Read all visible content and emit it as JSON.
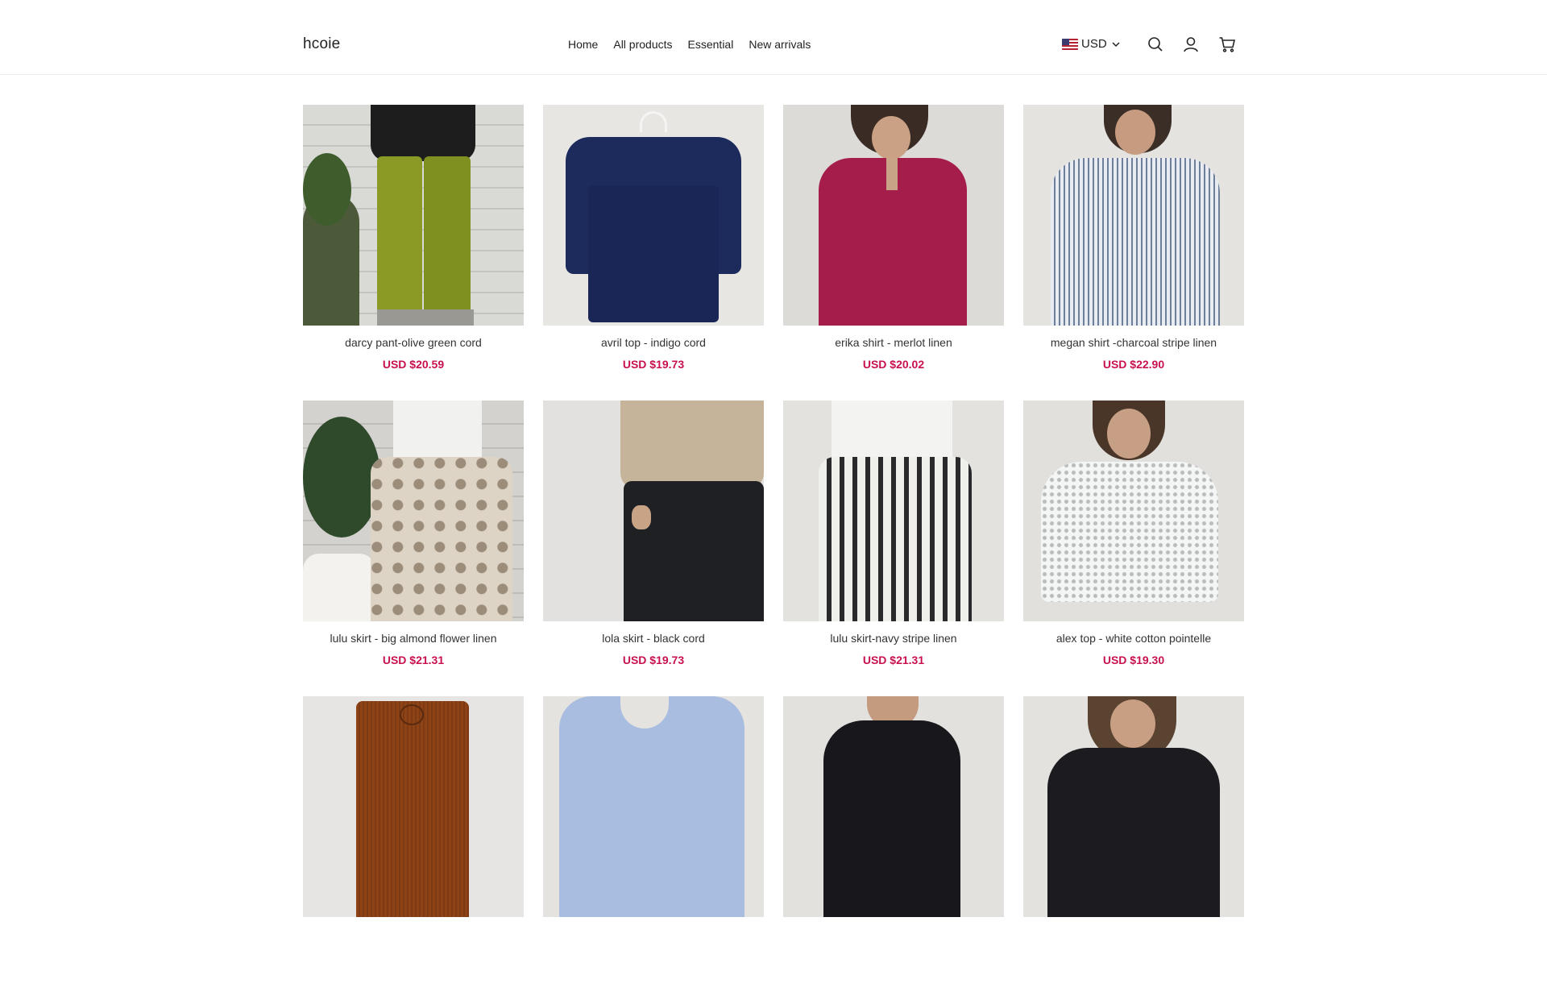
{
  "brand": {
    "logo": "hcoie"
  },
  "nav": {
    "items": [
      "Home",
      "All products",
      "Essential",
      "New arrivals"
    ]
  },
  "currency": {
    "label": "USD",
    "flag_icon": "us-flag-icon"
  },
  "header_icons": [
    "search-icon",
    "account-icon",
    "cart-icon"
  ],
  "colors": {
    "price": "#c8104f",
    "text": "#333333",
    "divider": "#ececec"
  },
  "products": [
    {
      "title": "darcy pant-olive green cord",
      "price": "USD $20.59",
      "image_icon": "olive-pants-photo"
    },
    {
      "title": "avril top - indigo cord",
      "price": "USD $19.73",
      "image_icon": "navy-top-photo"
    },
    {
      "title": "erika shirt - merlot linen",
      "price": "USD $20.02",
      "image_icon": "red-shirt-photo"
    },
    {
      "title": "megan shirt -charcoal stripe linen",
      "price": "USD $22.90",
      "image_icon": "striped-shirt-photo"
    },
    {
      "title": "lulu skirt - big almond flower linen",
      "price": "USD $21.31",
      "image_icon": "floral-skirt-photo"
    },
    {
      "title": "lola skirt - black cord",
      "price": "USD $19.73",
      "image_icon": "black-skirt-photo"
    },
    {
      "title": "lulu skirt-navy stripe linen",
      "price": "USD $21.31",
      "image_icon": "stripe-skirt-photo"
    },
    {
      "title": "alex top - white cotton pointelle",
      "price": "USD $19.30",
      "image_icon": "white-knit-top-photo"
    },
    {
      "title": "",
      "price": "",
      "image_icon": "brown-corduroy-shorts-photo"
    },
    {
      "title": "",
      "price": "",
      "image_icon": "light-blue-dress-photo"
    },
    {
      "title": "",
      "price": "",
      "image_icon": "black-top-photo"
    },
    {
      "title": "",
      "price": "",
      "image_icon": "black-shirt-photo"
    }
  ]
}
